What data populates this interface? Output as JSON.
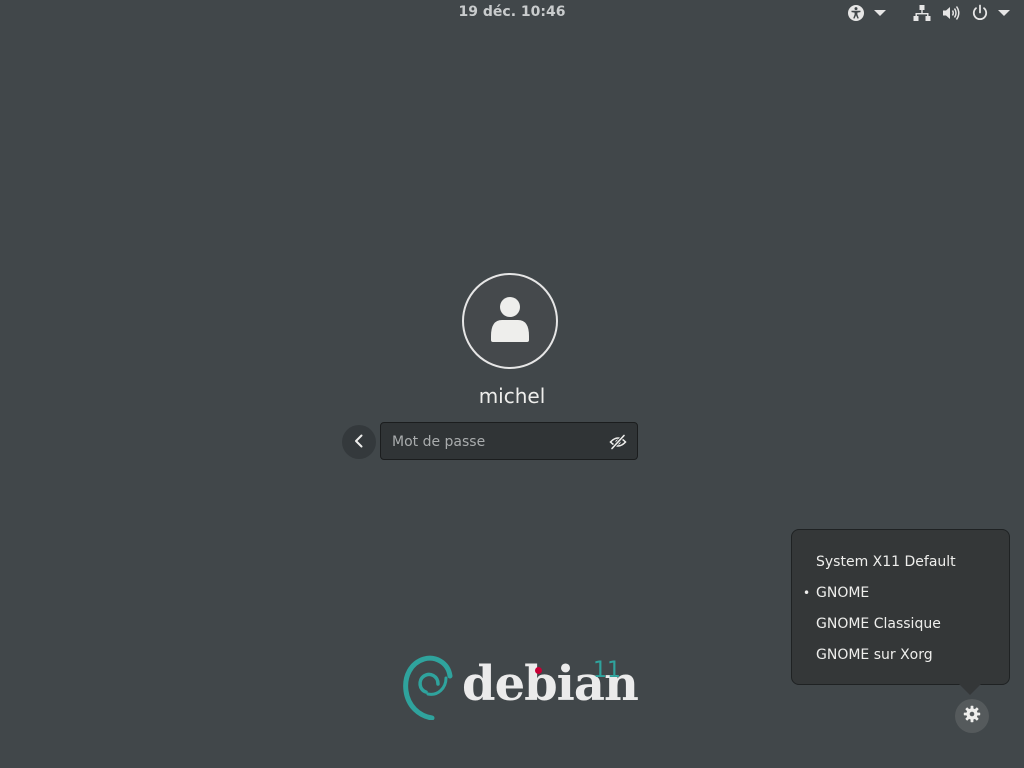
{
  "top_bar": {
    "clock": "19 déc.  10:46"
  },
  "login": {
    "username": "michel",
    "password_placeholder": "Mot de passe"
  },
  "session_menu": {
    "items": [
      {
        "label": "System X11 Default",
        "selected": false
      },
      {
        "label": "GNOME",
        "selected": true
      },
      {
        "label": "GNOME Classique",
        "selected": false
      },
      {
        "label": "GNOME sur Xorg",
        "selected": false
      }
    ],
    "bullet": "•"
  },
  "branding": {
    "wordmark": "debian",
    "version": "11",
    "swirl_color": "#2fa39d",
    "dot_color": "#c70036"
  },
  "icons": {
    "accessibility": "accessibility-icon",
    "network": "network-icon",
    "volume": "volume-icon",
    "power": "power-icon",
    "avatar": "user-avatar-icon",
    "back": "chevron-left-icon",
    "reveal": "eye-slash-icon",
    "session": "gear-icon"
  }
}
